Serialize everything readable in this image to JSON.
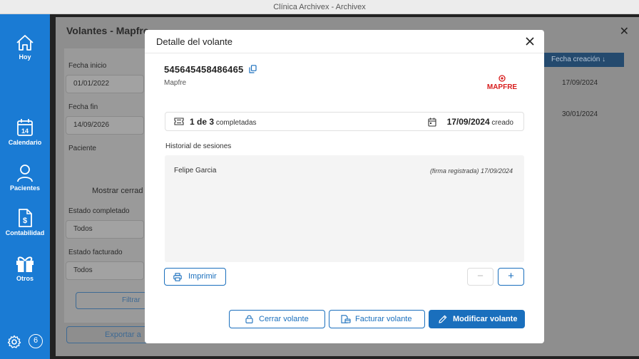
{
  "window": {
    "title": "Clínica Archivex - Archivex"
  },
  "sidebar": {
    "items": [
      {
        "label": "Hoy",
        "icon": "home-icon"
      },
      {
        "label": "Calendario",
        "icon": "calendar-icon",
        "day": "14"
      },
      {
        "label": "Pacientes",
        "icon": "person-icon"
      },
      {
        "label": "Contabilidad",
        "icon": "invoice-icon"
      },
      {
        "label": "Otros",
        "icon": "gift-icon"
      }
    ],
    "badge_count": "6"
  },
  "background": {
    "title": "Volantes - Mapfre",
    "filters": [
      {
        "label": "Fecha inicio",
        "value": "01/01/2022"
      },
      {
        "label": "Fecha fin",
        "value": "14/09/2026"
      },
      {
        "label": "Paciente",
        "value": ""
      },
      {
        "label": "Estado completado",
        "value": "Todos"
      },
      {
        "label": "Estado facturado",
        "value": "Todos"
      }
    ],
    "checkbox_label": "Mostrar cerrad",
    "filter_button": "Filtrar",
    "export_button": "Exportar a",
    "table_header": "Fecha creación ↓",
    "table_rows": [
      "17/09/2024",
      "30/01/2024"
    ]
  },
  "modal": {
    "title": "Detalle del volante",
    "volante_number": "545645458486465",
    "insurer": "Mapfre",
    "logo_text": "MAPFRE",
    "sessions_done": "1 de 3",
    "sessions_label": "completadas",
    "created_date": "17/09/2024",
    "created_label": "creado",
    "history_title": "Historial de sesiones",
    "history": [
      {
        "patient": "Felipe Garcia",
        "meta": "(firma registrada) 17/09/2024"
      }
    ],
    "print_button": "Imprimir",
    "minus_button": "−",
    "plus_button": "+",
    "close_volante_button": "Cerrar volante",
    "invoice_volante_button": "Facturar volante",
    "edit_volante_button": "Modificar volante"
  },
  "colors": {
    "sidebar": "#1a7bd4",
    "primary": "#1a6fbd",
    "mapfre_red": "#d81e1e"
  }
}
